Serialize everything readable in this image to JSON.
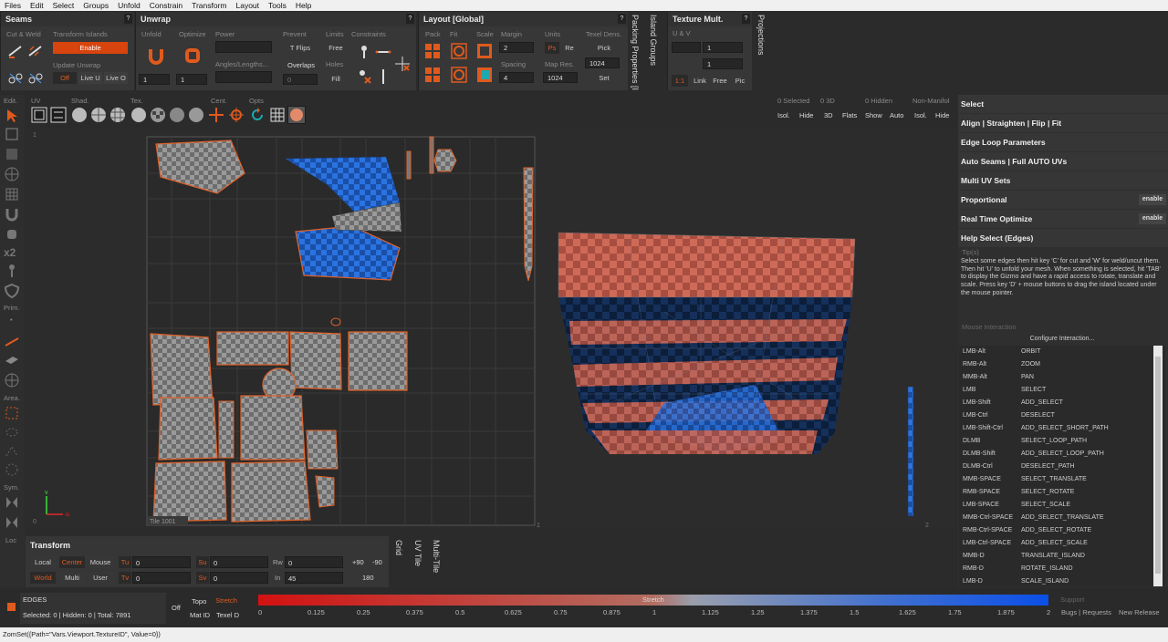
{
  "menu": [
    "Files",
    "Edit",
    "Select",
    "Groups",
    "Unfold",
    "Constrain",
    "Transform",
    "Layout",
    "Tools",
    "Help"
  ],
  "seams": {
    "title": "Seams",
    "cut_weld": "Cut & Weld",
    "transform_islands": "Transform Islands",
    "enable": "Enable",
    "update_unwrap": "Update Unwrap",
    "off": "Off",
    "live_u": "Live U",
    "live_o": "Live O"
  },
  "unwrap": {
    "title": "Unwrap",
    "unfold": "Unfold",
    "optimize": "Optimize",
    "power": "Power",
    "angles_lengths": "Angles/Lengths...",
    "prevent": "Prevent",
    "t_flips": "T Flips",
    "overlaps": "Overlaps",
    "limits": "Limits",
    "free": "Free",
    "holes": "Holes",
    "fill": "Fill",
    "constraints": "Constraints",
    "unfold_val": "1",
    "optimize_val": "1",
    "overlaps_val": "0"
  },
  "layout": {
    "title": "Layout [Global]",
    "pack": "Pack",
    "fit": "Fit",
    "scale": "Scale",
    "margin": "Margin",
    "margin_val": "2",
    "spacing": "Spacing",
    "spacing_val": "4",
    "units": "Units",
    "ps": "Ps",
    "re": "Re",
    "map_res": "Map Res.",
    "map_res_val": "1024",
    "texel_dens": "Texel Dens.",
    "pick": "Pick",
    "texel_val": "1024",
    "set": "Set"
  },
  "side_tabs": [
    "Packing Properties [I",
    "Island Groups"
  ],
  "texture_mult": {
    "title": "Texture Mult.",
    "uv": "U & V",
    "u_val": "1",
    "v_val": "1",
    "one_one": "1:1",
    "link": "Link",
    "free": "Free",
    "pic": "Pic"
  },
  "projections": "Projections",
  "toolbar2": {
    "uv": "UV",
    "shad": "Shad.",
    "tex": "Tex.",
    "cent": "Cent.",
    "opts": "Opts",
    "selected": "0 Selected",
    "3d": "0 3D",
    "hidden": "0 Hidden",
    "nonmanifold": "Non-Manifol",
    "isol": "Isol.",
    "hide": "Hide",
    "threed": "3D",
    "flats": "Flats",
    "show": "Show",
    "auto": "Auto",
    "isol2": "Isol.",
    "hide2": "Hide"
  },
  "leftbar": {
    "edit": "Edit.",
    "prim": "Prim.",
    "area": "Area.",
    "sym": "Sym.",
    "loc": "Loc",
    "x2": "x2"
  },
  "viewport": {
    "tile": "Tile 1001",
    "axis_v": "v",
    "axis_u": "u",
    "zero": "0",
    "one": "1",
    "two": "2",
    "one_b": "1"
  },
  "rpanel": {
    "sections": [
      "Select",
      "Align | Straighten | Flip | Fit",
      "Edge Loop Parameters",
      "Auto Seams | Full AUTO UVs",
      "Multi UV Sets",
      "Proportional",
      "Real Time Optimize",
      "Help Select (Edges)"
    ],
    "proportional_toggle": "enable",
    "rto_toggle": "enable",
    "tips_label": "Tip(s)",
    "tips": "Select some edges then hit key 'C' for cut and 'W' for weld/uncut them. Then hit 'U' to unfold your mesh. When something is selected, hit 'TAB' to display the Gizmo and have a rapid access to rotate, translate and scale. Press key 'D' + mouse buttons to drag the island located under the mouse pointer.",
    "mouse_label": "Mouse Interaction",
    "configure": "Configure Interaction...",
    "mouse": [
      [
        "LMB-Alt",
        "ORBIT"
      ],
      [
        "RMB-Alt",
        "ZOOM"
      ],
      [
        "MMB-Alt",
        "PAN"
      ],
      [
        "LMB",
        "SELECT"
      ],
      [
        "LMB-Shift",
        "ADD_SELECT"
      ],
      [
        "LMB-Ctrl",
        "DESELECT"
      ],
      [
        "LMB-Shift-Ctrl",
        "ADD_SELECT_SHORT_PATH"
      ],
      [
        "DLMB",
        "SELECT_LOOP_PATH"
      ],
      [
        "DLMB-Shift",
        "ADD_SELECT_LOOP_PATH"
      ],
      [
        "DLMB-Ctrl",
        "DESELECT_PATH"
      ],
      [
        "MMB-SPACE",
        "SELECT_TRANSLATE"
      ],
      [
        "RMB-SPACE",
        "SELECT_ROTATE"
      ],
      [
        "LMB-SPACE",
        "SELECT_SCALE"
      ],
      [
        "MMB-Ctrl-SPACE",
        "ADD_SELECT_TRANSLATE"
      ],
      [
        "RMB-Ctrl-SPACE",
        "ADD_SELECT_ROTATE"
      ],
      [
        "LMB-Ctrl-SPACE",
        "ADD_SELECT_SCALE"
      ],
      [
        "MMB-D",
        "TRANSLATE_ISLAND"
      ],
      [
        "RMB-D",
        "ROTATE_ISLAND"
      ],
      [
        "LMB-D",
        "SCALE_ISLAND"
      ]
    ]
  },
  "transform": {
    "title": "Transform",
    "local": "Local",
    "center": "Center",
    "mouse": "Mouse",
    "tu": "Tu",
    "su": "Su",
    "rw": "Rw",
    "world": "World",
    "multi": "Multi",
    "user": "User",
    "tv": "Tv",
    "sv": "Sv",
    "in": "In",
    "tu_val": "0",
    "tv_val": "0",
    "su_val": "0",
    "sv_val": "0",
    "rw_val": "0",
    "in_val": "45",
    "p90": "+90",
    "m90": "-90",
    "one80": "180",
    "tabs": [
      "Grid",
      "UV Tile",
      "Multi-Tile"
    ]
  },
  "status": {
    "mode": "EDGES",
    "counts": "Selected: 0 | Hidden: 0 | Total: 7891",
    "off": "Off",
    "topo": "Topo",
    "stretch": "Stretch",
    "mat_id": "Mat ID",
    "texel_d": "Texel D",
    "bar_label": "Stretch",
    "ticks": [
      "0",
      "0.125",
      "0.25",
      "0.375",
      "0.5",
      "0.625",
      "0.75",
      "0.875",
      "1",
      "1.125",
      "1.25",
      "1.375",
      "1.5",
      "1.625",
      "1.75",
      "1.875",
      "2"
    ],
    "support": "Support",
    "bugs": "Bugs | Requests",
    "new_release": "New Release"
  },
  "cmdline": "ZomSet({Path=\"Vars.Viewport.TextureID\", Value=0})",
  "colors": {
    "accent": "#d8440d",
    "checker_red": "#c15a4a",
    "checker_blue": "#1f63c9",
    "dark_blue": "#0f2647",
    "gray_check": "#8a8a8a"
  }
}
